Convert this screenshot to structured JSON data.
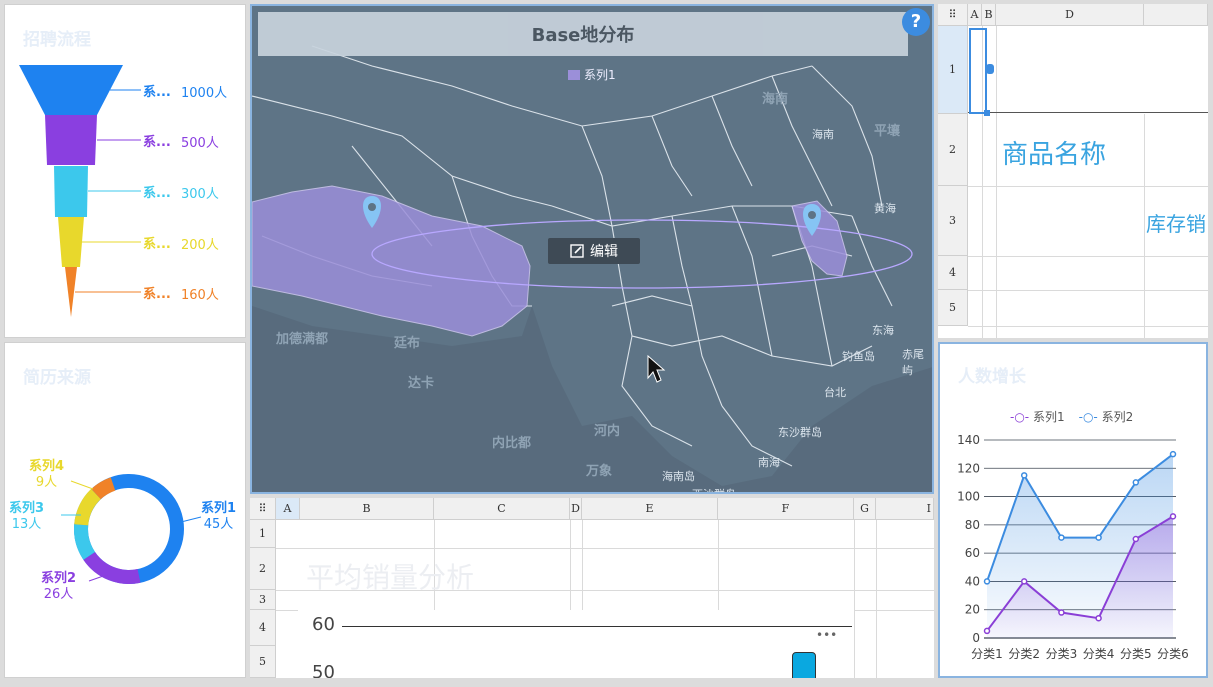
{
  "funnel": {
    "title": "招聘流程",
    "items": [
      {
        "label": "系...",
        "value": "1000人",
        "color": "#1e82f0"
      },
      {
        "label": "系...",
        "value": "500人",
        "color": "#8a3fe0"
      },
      {
        "label": "系...",
        "value": "300人",
        "color": "#3cc8ec"
      },
      {
        "label": "系...",
        "value": "200人",
        "color": "#e8d82c"
      },
      {
        "label": "系...",
        "value": "160人",
        "color": "#f08228"
      }
    ]
  },
  "donut": {
    "title": "简历来源",
    "items": [
      {
        "name": "系列1",
        "value": "45人",
        "color": "#1e82f0"
      },
      {
        "name": "系列2",
        "value": "26人",
        "color": "#8a3fe0"
      },
      {
        "name": "系列3",
        "value": "13人",
        "color": "#3cc8ec"
      },
      {
        "name": "系列4",
        "value": "9人",
        "color": "#e8d82c"
      }
    ]
  },
  "map": {
    "title": "Base地分布",
    "legend": "系列1",
    "help": "?",
    "edit_label": "编辑",
    "places": {
      "hainan": "海南",
      "pingrang": "平壤",
      "huanghai": "黄海",
      "jiademandu": "加德满都",
      "tingbu": "廷布",
      "donghai": "东海",
      "diaoyudao": "钓鱼岛",
      "chiweiyu": "赤尾屿",
      "daka": "达卡",
      "taibei": "台北",
      "neibidu": "内比都",
      "henei": "河内",
      "dongsha": "东沙群岛",
      "wanxiang": "万象",
      "nanhai": "南海",
      "hainandao": "海南岛",
      "xisha": "西沙群岛"
    }
  },
  "sheet_top": {
    "cols": [
      "A",
      "B",
      "D"
    ],
    "rows": [
      "1",
      "2",
      "3",
      "4",
      "5"
    ],
    "cell_product": "商品名称",
    "cell_stock": "库存销"
  },
  "sheet_bottom": {
    "cols": [
      "A",
      "B",
      "C",
      "D",
      "E",
      "F",
      "G",
      "I"
    ],
    "rows": [
      "1",
      "2",
      "3",
      "4",
      "5"
    ],
    "title": "平均销量分析",
    "axis_60": "60",
    "axis_50": "50",
    "more": "•••"
  },
  "line_panel": {
    "title": "人数增长",
    "legend": [
      "系列1",
      "系列2"
    ]
  },
  "chart_data": {
    "type": "area",
    "title": "人数增长",
    "categories": [
      "分类1",
      "分类2",
      "分类3",
      "分类4",
      "分类5",
      "分类6"
    ],
    "ylim": [
      0,
      140
    ],
    "yticks": [
      0,
      20,
      40,
      60,
      80,
      100,
      120,
      140
    ],
    "series": [
      {
        "name": "系列1",
        "color": "#8a3fd6",
        "values": [
          5,
          40,
          18,
          14,
          70,
          86
        ]
      },
      {
        "name": "系列2",
        "color": "#3c8ce0",
        "values": [
          40,
          115,
          71,
          71,
          110,
          130
        ]
      }
    ],
    "legend_position": "top",
    "grid": true
  }
}
